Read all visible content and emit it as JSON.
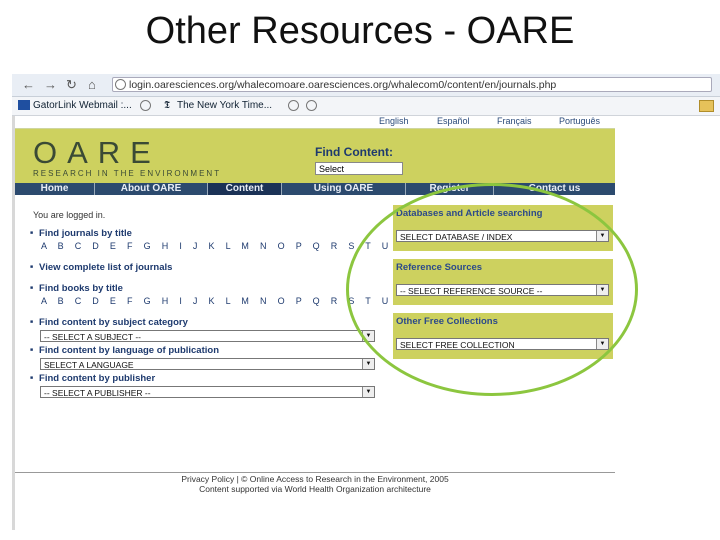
{
  "slide": {
    "title": "Other Resources - OARE"
  },
  "browser": {
    "url": "login.oaresciences.org/whalecomoare.oaresciences.org/whalecom0/content/en/journals.php",
    "bookmarks": [
      "GatorLink Webmail :...",
      "The New York Time..."
    ]
  },
  "top_links": [
    "English",
    "Español",
    "Français",
    "Português"
  ],
  "banner": {
    "logo": "OARE",
    "logo_sub": "RESEARCH IN THE ENVIRONMENT",
    "find_content_label": "Find Content:",
    "find_content_select": "Select"
  },
  "nav": [
    "Home",
    "About OARE",
    "Content",
    "Using OARE",
    "Register",
    "Contact us"
  ],
  "left": {
    "logged_in": "You are logged in.",
    "journals_title": "Find journals by title",
    "alphabet": "A B C D E F G H I J K L M N O P Q R S T U V W X Y Z",
    "complete_list": "View complete list of journals",
    "books_title": "Find books by title",
    "by_subject": "Find content by subject category",
    "subject_select": "-- SELECT A SUBJECT --",
    "by_language": "Find content by language of publication",
    "language_select": "SELECT A LANGUAGE",
    "by_publisher": "Find content by publisher",
    "publisher_select": "-- SELECT A PUBLISHER --"
  },
  "right": {
    "db_title": "Databases and Article searching",
    "db_select": "SELECT DATABASE / INDEX",
    "ref_title": "Reference Sources",
    "ref_select": "-- SELECT REFERENCE SOURCE --",
    "free_title": "Other Free Collections",
    "free_select": "SELECT FREE COLLECTION"
  },
  "footer": {
    "line1": "Privacy Policy | © Online Access to Research in the Environment, 2005",
    "line2": "Content supported via World Health Organization architecture"
  },
  "colors": {
    "banner": "#cdd15f",
    "nav": "#2c4a6e",
    "highlight": "#8cc63f"
  }
}
